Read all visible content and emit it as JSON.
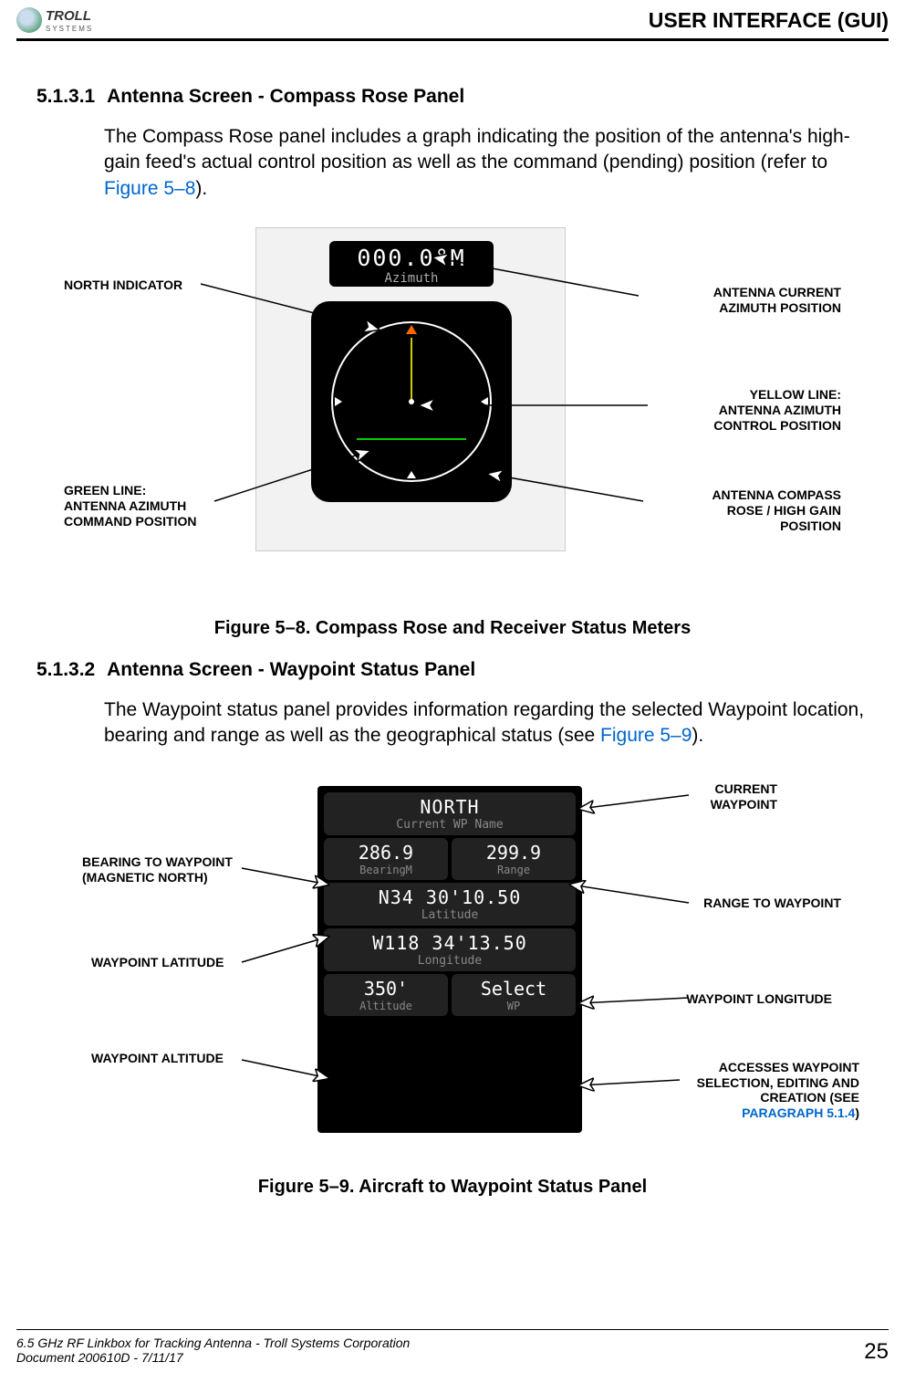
{
  "header": {
    "logo_text": "TROLL",
    "logo_sub": "SYSTEMS",
    "title": "USER INTERFACE (GUI)"
  },
  "section1": {
    "num": "5.1.3.1",
    "title": "Antenna Screen - Compass Rose Panel",
    "body_pre": "The Compass Rose panel includes a graph indicating the position of the antenna's high-gain feed's actual control position as well as the command (pending) position (refer to ",
    "xref": "Figure 5–8",
    "body_post": ")."
  },
  "fig1": {
    "readout_value": "000.0°M",
    "readout_label": "Azimuth",
    "callouts": {
      "north": "NORTH INDICATOR",
      "green": "GREEN LINE:\nANTENNA AZIMUTH\nCOMMAND POSITION",
      "current": "ANTENNA CURRENT\nAZIMUTH POSITION",
      "yellow": "YELLOW LINE:\nANTENNA AZIMUTH\nCONTROL POSITION",
      "compass": "ANTENNA COMPASS\nROSE / HIGH GAIN\nPOSITION"
    },
    "caption": "Figure 5–8.  Compass Rose and Receiver Status Meters"
  },
  "section2": {
    "num": "5.1.3.2",
    "title": "Antenna Screen - Waypoint Status Panel",
    "body_pre": "The Waypoint status panel provides information regarding the selected Waypoint location, bearing and range as well as the geographical status (see ",
    "xref": "Figure 5–9",
    "body_post": ")."
  },
  "fig2": {
    "wp_name": "NORTH",
    "wp_name_sub": "Current WP Name",
    "bearing_val": "286.9",
    "bearing_sub": "BearingM",
    "range_val": "299.9",
    "range_sub": "Range",
    "lat_val": "N34 30'10.50",
    "lat_sub": "Latitude",
    "lon_val": "W118 34'13.50",
    "lon_sub": "Longitude",
    "alt_val": "350'",
    "alt_sub": "Altitude",
    "sel_val": "Select",
    "sel_sub": "WP",
    "callouts": {
      "current_wp": "CURRENT\nWAYPOINT",
      "bearing": "BEARING TO WAYPOINT\n(MAGNETIC NORTH)",
      "range": "RANGE TO WAYPOINT",
      "lat": "WAYPOINT LATITUDE",
      "lon": "WAYPOINT LONGITUDE",
      "alt": "WAYPOINT ALTITUDE",
      "select_pre": "ACCESSES WAYPOINT\nSELECTION, EDITING AND\nCREATION (SEE\n",
      "select_xref": "PARAGRAPH 5.1.4",
      "select_post": ")"
    },
    "caption": "Figure 5–9.  Aircraft to Waypoint Status Panel"
  },
  "footer": {
    "line1": "6.5 GHz RF Linkbox for Tracking Antenna - Troll Systems Corporation",
    "line2": "Document 200610D - 7/11/17",
    "page": "25"
  }
}
